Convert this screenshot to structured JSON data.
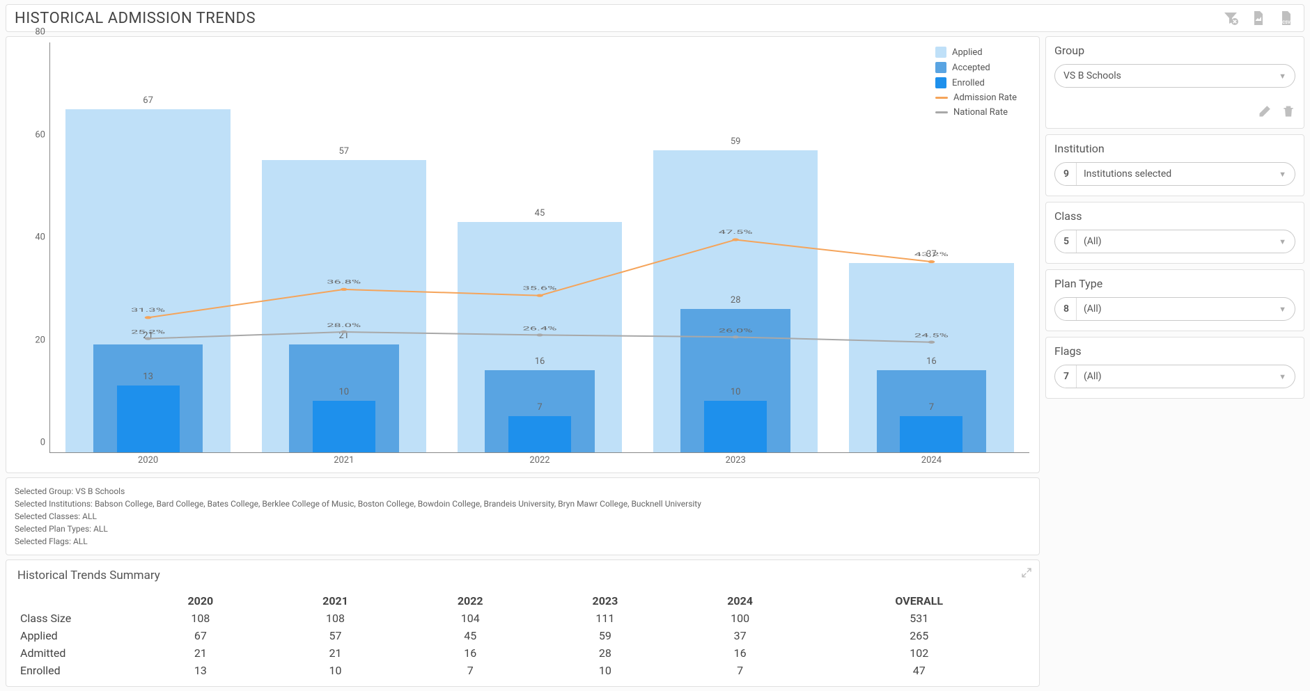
{
  "header": {
    "title": "HISTORICAL ADMISSION TRENDS"
  },
  "chart_data": {
    "type": "bar",
    "categories": [
      "2020",
      "2021",
      "2022",
      "2023",
      "2024"
    ],
    "ylim": [
      0,
      80
    ],
    "yticks": [
      0,
      20,
      40,
      60,
      80
    ],
    "series": [
      {
        "name": "Applied",
        "values": [
          67,
          57,
          45,
          59,
          37
        ]
      },
      {
        "name": "Accepted",
        "values": [
          21,
          21,
          16,
          28,
          16
        ]
      },
      {
        "name": "Enrolled",
        "values": [
          13,
          10,
          7,
          10,
          7
        ]
      }
    ],
    "line_series": [
      {
        "name": "Admission Rate",
        "values_pct": [
          31.3,
          36.8,
          35.6,
          47.5,
          43.2
        ]
      },
      {
        "name": "National Rate",
        "values_pct": [
          25.2,
          28.0,
          26.4,
          26.0,
          24.5
        ]
      }
    ],
    "line_scale_note": "Line series use an independent percentage scale; approximate visual positions on the left 0-80 count axis are ~[26.3,31.8,30.6,41.5,37.2] for Admission Rate and ~[22.2,23.5,22.9,22.5,21.5] for National Rate.",
    "legend": [
      "Applied",
      "Accepted",
      "Enrolled",
      "Admission Rate",
      "National Rate"
    ]
  },
  "info": {
    "group_line": "Selected Group: VS B Schools",
    "inst_line": "Selected Institutions: Babson College, Bard College, Bates College, Berklee College of Music, Boston College, Bowdoin College, Brandeis University, Bryn Mawr College, Bucknell University",
    "classes_line": "Selected Classes: ALL",
    "plan_line": "Selected Plan Types: ALL",
    "flags_line": "Selected Flags: ALL"
  },
  "summary": {
    "title": "Historical Trends Summary",
    "columns": [
      "2020",
      "2021",
      "2022",
      "2023",
      "2024",
      "OVERALL"
    ],
    "rows": [
      {
        "label": "Class Size",
        "values": [
          108,
          108,
          104,
          111,
          100,
          531
        ]
      },
      {
        "label": "Applied",
        "values": [
          67,
          57,
          45,
          59,
          37,
          265
        ]
      },
      {
        "label": "Admitted",
        "values": [
          21,
          21,
          16,
          28,
          16,
          102
        ]
      },
      {
        "label": "Enrolled",
        "values": [
          13,
          10,
          7,
          10,
          7,
          47
        ]
      }
    ]
  },
  "filters": {
    "group": {
      "title": "Group",
      "value": "VS B Schools"
    },
    "institution": {
      "title": "Institution",
      "count": "9",
      "value": "Institutions selected"
    },
    "class": {
      "title": "Class",
      "count": "5",
      "value": "(All)"
    },
    "plan_type": {
      "title": "Plan Type",
      "count": "8",
      "value": "(All)"
    },
    "flags": {
      "title": "Flags",
      "count": "7",
      "value": "(All)"
    }
  },
  "colors": {
    "applied": "#bfe0f8",
    "accepted": "#59a4e2",
    "enrolled": "#1e90ec",
    "admission": "#f5a45a",
    "national": "#a8a8a8"
  }
}
